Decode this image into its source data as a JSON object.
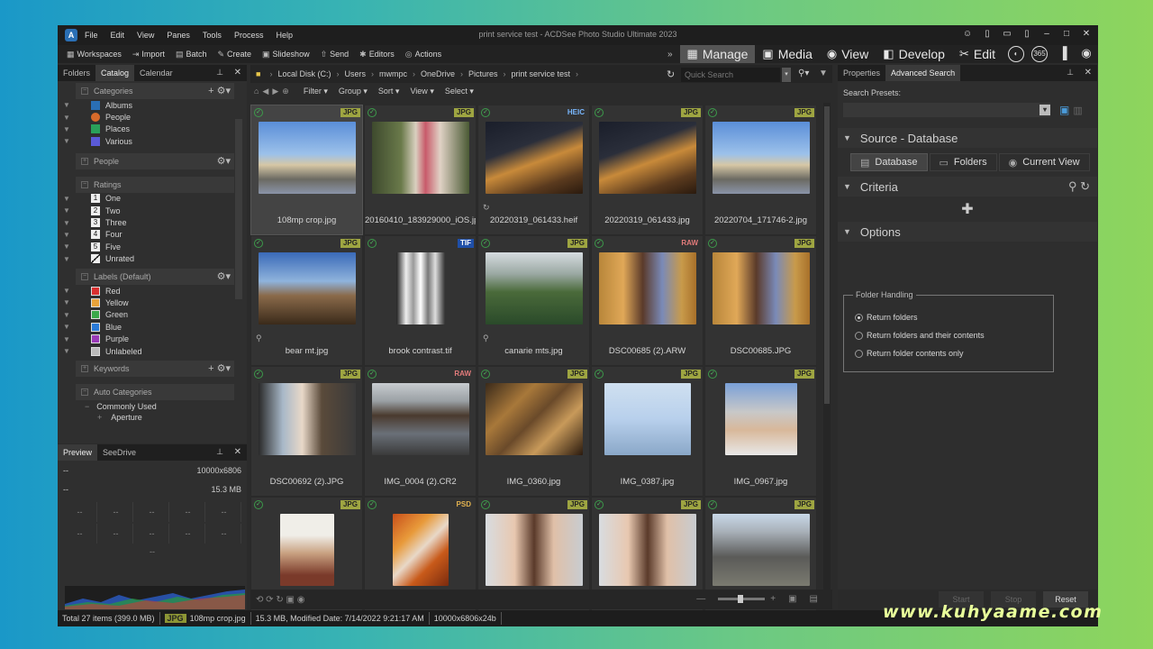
{
  "window_title": "print service test - ACDSee Photo Studio Ultimate 2023",
  "menu": [
    "File",
    "Edit",
    "View",
    "Panes",
    "Tools",
    "Process",
    "Help"
  ],
  "toolbar": [
    "Workspaces",
    "Import",
    "Batch",
    "Create",
    "Slideshow",
    "Send",
    "Editors",
    "Actions"
  ],
  "modes": [
    "Manage",
    "Media",
    "View",
    "Develop",
    "Edit"
  ],
  "left_tabs": [
    "Folders",
    "Catalog",
    "Calendar"
  ],
  "catalog": {
    "categories_label": "Categories",
    "categories": [
      "Albums",
      "People",
      "Places",
      "Various"
    ],
    "people_label": "People",
    "ratings_label": "Ratings",
    "ratings": [
      "One",
      "Two",
      "Three",
      "Four",
      "Five",
      "Unrated"
    ],
    "labels_label": "Labels (Default)",
    "labels": [
      {
        "name": "Red",
        "color": "#d93030"
      },
      {
        "name": "Yellow",
        "color": "#e8a23a"
      },
      {
        "name": "Green",
        "color": "#3aa84a"
      },
      {
        "name": "Blue",
        "color": "#2a7ad8"
      },
      {
        "name": "Purple",
        "color": "#9a3ab8"
      },
      {
        "name": "Unlabeled",
        "color": "#bbbbbb"
      }
    ],
    "keywords_label": "Keywords",
    "auto_label": "Auto Categories",
    "commonly_used": "Commonly Used",
    "aperture": "Aperture"
  },
  "preview_tabs": [
    "Preview",
    "SeeDrive"
  ],
  "preview": {
    "dim": "10000x6806",
    "size": "15.3 MB",
    "dash": "--"
  },
  "path": [
    "Local Disk (C:)",
    "Users",
    "mwmpc",
    "OneDrive",
    "Pictures",
    "print service test"
  ],
  "quick_search": "Quick Search",
  "filterbar": [
    "Filter",
    "Group",
    "Sort",
    "View",
    "Select"
  ],
  "files": [
    {
      "name": "108mp crop.jpg",
      "badge": "JPG",
      "thumb": "city"
    },
    {
      "name": "20160410_183929000_iOS.jpg",
      "badge": "JPG",
      "thumb": "people"
    },
    {
      "name": "20220319_061433.heif",
      "badge": "HEIC",
      "thumb": "street"
    },
    {
      "name": "20220319_061433.jpg",
      "badge": "JPG",
      "thumb": "street"
    },
    {
      "name": "20220704_171746-2.jpg",
      "badge": "JPG",
      "thumb": "city"
    },
    {
      "name": "bear mt.jpg",
      "badge": "JPG",
      "thumb": "mountain"
    },
    {
      "name": "brook contrast.tif",
      "badge": "TIF",
      "thumb": "bw"
    },
    {
      "name": "canarie mts.jpg",
      "badge": "JPG",
      "thumb": "valley"
    },
    {
      "name": "DSC00685 (2).ARW",
      "badge": "RAW",
      "thumb": "man"
    },
    {
      "name": "DSC00685.JPG",
      "badge": "JPG",
      "thumb": "man"
    },
    {
      "name": "DSC00692 (2).JPG",
      "badge": "JPG",
      "thumb": "desk"
    },
    {
      "name": "IMG_0004 (2).CR2",
      "badge": "RAW",
      "thumb": "lake"
    },
    {
      "name": "IMG_0360.jpg",
      "badge": "JPG",
      "thumb": "bird"
    },
    {
      "name": "IMG_0387.jpg",
      "badge": "JPG",
      "thumb": "bird2"
    },
    {
      "name": "IMG_0967.jpg",
      "badge": "JPG",
      "thumb": "hat"
    },
    {
      "name": "",
      "badge": "JPG",
      "thumb": "portrait"
    },
    {
      "name": "",
      "badge": "PSD",
      "thumb": "autumn"
    },
    {
      "name": "",
      "badge": "JPG",
      "thumb": "boy"
    },
    {
      "name": "",
      "badge": "JPG",
      "thumb": "boy"
    },
    {
      "name": "",
      "badge": "JPG",
      "thumb": "aerial"
    }
  ],
  "right_tabs": [
    "Properties",
    "Advanced Search"
  ],
  "search": {
    "presets_label": "Search Presets:",
    "source_label": "Source - Database",
    "source_buttons": [
      "Database",
      "Folders",
      "Current View"
    ],
    "criteria_label": "Criteria",
    "options_label": "Options",
    "folder_handling": "Folder Handling",
    "radios": [
      "Return folders",
      "Return folders and their contents",
      "Return folder contents only"
    ],
    "buttons": [
      "Start",
      "Stop",
      "Reset"
    ]
  },
  "status": {
    "total": "Total 27 items  (399.0 MB)",
    "file_badge": "JPG",
    "file": "108mp crop.jpg",
    "info": "15.3 MB, Modified Date: 7/14/2022 9:21:17 AM",
    "dims": "10000x6806x24b"
  },
  "watermark": "www.kuhyaame.com"
}
